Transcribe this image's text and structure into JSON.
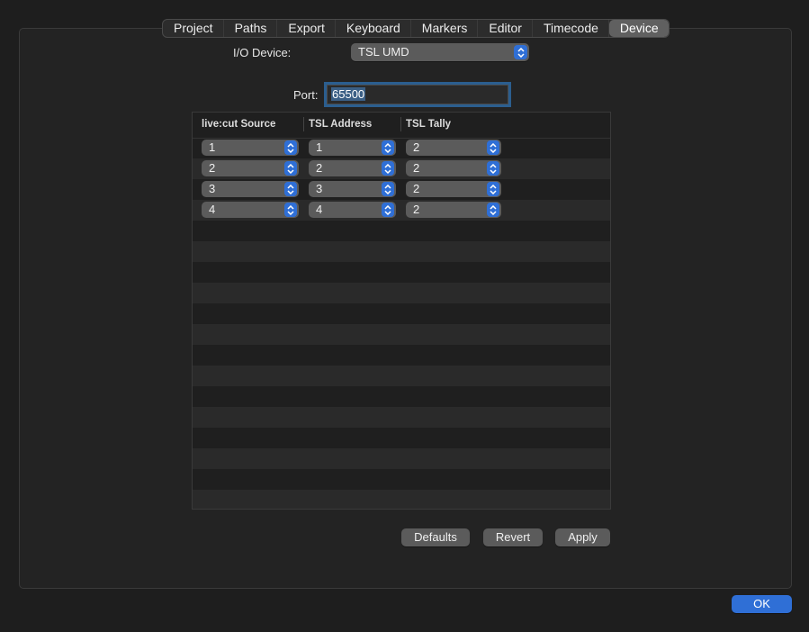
{
  "tabs": [
    {
      "label": "Project",
      "active": false
    },
    {
      "label": "Paths",
      "active": false
    },
    {
      "label": "Export",
      "active": false
    },
    {
      "label": "Keyboard",
      "active": false
    },
    {
      "label": "Markers",
      "active": false
    },
    {
      "label": "Editor",
      "active": false
    },
    {
      "label": "Timecode",
      "active": false
    },
    {
      "label": "Device",
      "active": true
    }
  ],
  "io_device": {
    "label": "I/O Device:",
    "value": "TSL UMD"
  },
  "port": {
    "label": "Port:",
    "value": "65500"
  },
  "table": {
    "columns": [
      "live:cut Source",
      "TSL Address",
      "TSL Tally"
    ],
    "rows": [
      [
        "1",
        "1",
        "2"
      ],
      [
        "2",
        "2",
        "2"
      ],
      [
        "3",
        "3",
        "2"
      ],
      [
        "4",
        "4",
        "2"
      ]
    ]
  },
  "buttons": {
    "defaults": "Defaults",
    "revert": "Revert",
    "apply": "Apply",
    "ok": "OK"
  },
  "colors": {
    "accent": "#2f6fd6",
    "background": "#1e1e1e",
    "control": "#5b5b5b"
  },
  "icons": {
    "stepper": "up-down-chevron-icon"
  }
}
